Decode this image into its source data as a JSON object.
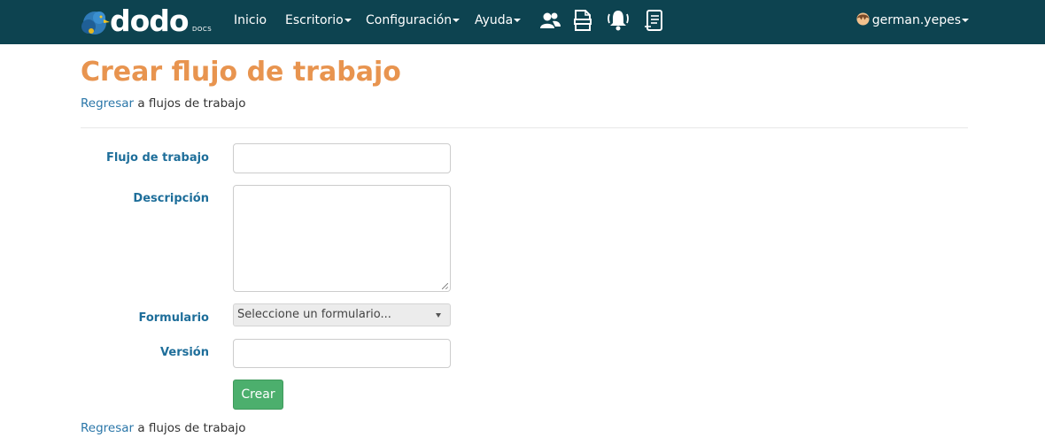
{
  "navbar": {
    "brand": {
      "word": "dodo",
      "sub": "DOCS"
    },
    "items": [
      {
        "label": "Inicio"
      },
      {
        "label": "Escritorio"
      },
      {
        "label": "Configuración"
      },
      {
        "label": "Ayuda"
      }
    ],
    "icons": [
      "users-icon",
      "xlsx-file-icon",
      "bell-icon",
      "document-list-icon"
    ],
    "user": {
      "name": "german.yepes"
    }
  },
  "page": {
    "title": "Crear flujo de trabajo",
    "back_top": {
      "link": "Regresar",
      "text": " a flujos de trabajo"
    },
    "back_bottom": {
      "link": "Regresar",
      "text": " a flujos de trabajo"
    }
  },
  "form": {
    "workflow": {
      "label": "Flujo de trabajo",
      "value": ""
    },
    "description": {
      "label": "Descripción",
      "value": ""
    },
    "form_select": {
      "label": "Formulario",
      "selected": "Seleccione un formulario..."
    },
    "version": {
      "label": "Versión",
      "value": ""
    },
    "submit_label": "Crear"
  },
  "colors": {
    "navbar_bg": "#0d4350",
    "title": "#e8944f",
    "label": "#1e6e9a",
    "link": "#2a76a8",
    "button": "#4caf6d"
  }
}
